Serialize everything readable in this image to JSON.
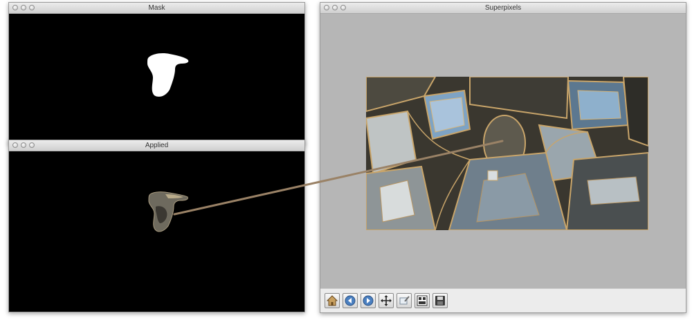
{
  "windows": {
    "mask": {
      "title": "Mask"
    },
    "applied": {
      "title": "Applied"
    },
    "superpixels": {
      "title": "Superpixels"
    }
  },
  "toolbar": {
    "buttons": [
      {
        "name": "home",
        "icon": "home-icon"
      },
      {
        "name": "back",
        "icon": "back-arrow-icon"
      },
      {
        "name": "forward",
        "icon": "forward-arrow-icon"
      },
      {
        "name": "pan",
        "icon": "move-icon"
      },
      {
        "name": "zoom",
        "icon": "zoom-rect-icon"
      },
      {
        "name": "subplots",
        "icon": "configure-subplots-icon"
      },
      {
        "name": "save",
        "icon": "save-disk-icon"
      }
    ]
  },
  "colors": {
    "window_bg": "#000000",
    "figure_bg": "#b6b6b6",
    "connector": "#9a8266",
    "mask_fill": "#ffffff"
  }
}
